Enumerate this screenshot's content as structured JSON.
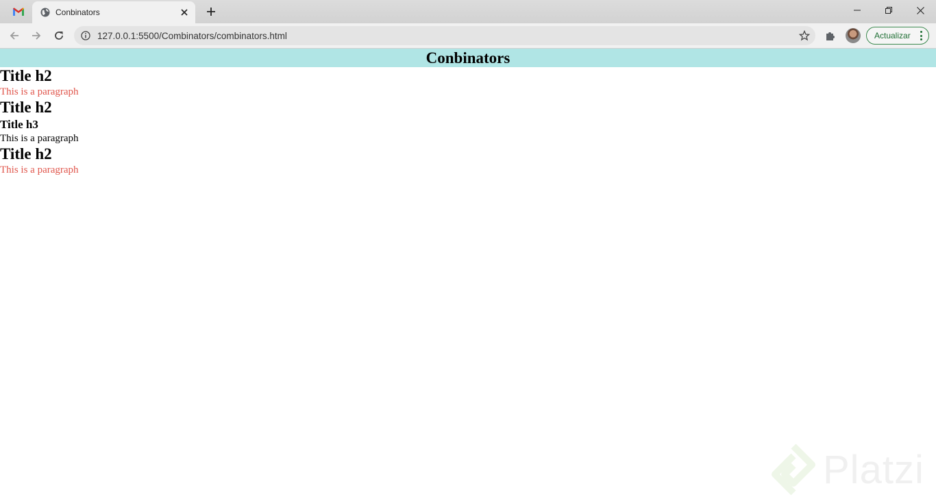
{
  "browser": {
    "tab_title": "Conbinators",
    "url": "127.0.0.1:5500/Combinators/combinators.html",
    "update_label": "Actualizar"
  },
  "page": {
    "header": "Conbinators",
    "blocks": [
      {
        "type": "h2",
        "text": "Title h2"
      },
      {
        "type": "p",
        "text": "This is a paragraph",
        "color": "#e0554b"
      },
      {
        "type": "h2",
        "text": "Title h2"
      },
      {
        "type": "h3",
        "text": "Title h3"
      },
      {
        "type": "p",
        "text": "This is a paragraph",
        "color": "#000000"
      },
      {
        "type": "h2",
        "text": "Title h2"
      },
      {
        "type": "p",
        "text": "This is a paragraph",
        "color": "#e0554b"
      }
    ],
    "header_bg": "#b0e5e5"
  },
  "watermark": {
    "text": "Platzi"
  },
  "icons": [
    "gmail-icon",
    "globe-icon",
    "close-icon",
    "plus-icon",
    "minimize-icon",
    "restore-icon",
    "window-close-icon",
    "back-arrow-icon",
    "forward-arrow-icon",
    "reload-icon",
    "info-icon",
    "star-icon",
    "puzzle-icon",
    "avatar",
    "kebab-menu-icon"
  ]
}
